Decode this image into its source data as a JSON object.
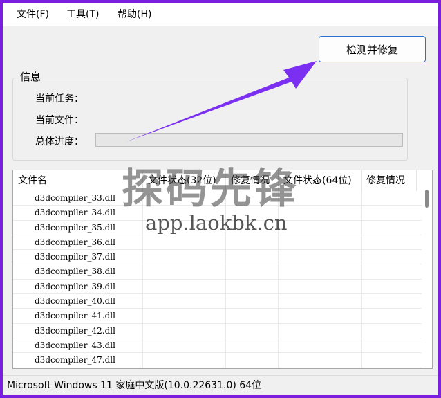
{
  "menu": {
    "file": "文件(F)",
    "tools": "工具(T)",
    "help": "帮助(H)"
  },
  "actions": {
    "detect_repair": "检测并修复"
  },
  "info": {
    "title": "信息",
    "current_task_label": "当前任务：",
    "current_task_value": "",
    "current_file_label": "当前文件：",
    "current_file_value": "",
    "overall_progress_label": "总体进度：",
    "overall_progress_value": 0
  },
  "table": {
    "columns": [
      "文件名",
      "文件状态(32位)",
      "修复情况",
      "文件状态(64位)",
      "修复情况"
    ],
    "rows": [
      "d3dcompiler_33.dll",
      "d3dcompiler_34.dll",
      "d3dcompiler_35.dll",
      "d3dcompiler_36.dll",
      "d3dcompiler_37.dll",
      "d3dcompiler_38.dll",
      "d3dcompiler_39.dll",
      "d3dcompiler_40.dll",
      "d3dcompiler_41.dll",
      "d3dcompiler_42.dll",
      "d3dcompiler_43.dll",
      "d3dcompiler_47.dll"
    ]
  },
  "status_bar": "Microsoft Windows 11 家庭中文版(10.0.22631.0) 64位",
  "watermark": {
    "brand": "探码先锋",
    "url": "app.laokbk.cn"
  },
  "colors": {
    "frame": "#7a1fe0",
    "annotation_arrow": "#7b2ff0",
    "button_border": "#2a6fd1"
  }
}
